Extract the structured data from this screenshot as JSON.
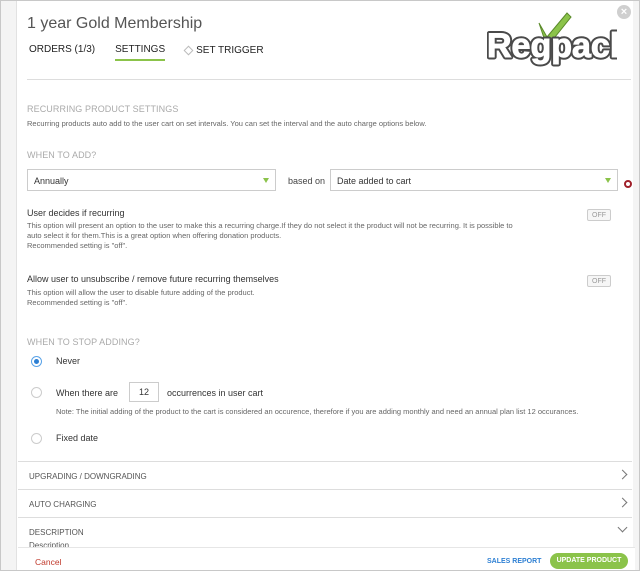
{
  "header": {
    "title": "1 year Gold Membership",
    "close_icon": "close-icon",
    "logo_text": "Regpack"
  },
  "tabs": [
    {
      "label": "ORDERS (1/3)",
      "active": false
    },
    {
      "label": "SETTINGS",
      "active": true
    },
    {
      "label": "SET TRIGGER",
      "active": false
    }
  ],
  "recurring": {
    "title": "RECURRING PRODUCT SETTINGS",
    "description": "Recurring products auto add to the user cart on set intervals. You can set the interval and the auto charge options below."
  },
  "when_to_add": {
    "title": "WHEN TO ADD?",
    "interval_value": "Annually",
    "based_on_label": "based on",
    "based_on_value": "Date added to cart"
  },
  "options": [
    {
      "title": "User decides if recurring",
      "lines": [
        "This option will present an option to the user to make this a recurring charge.If they do not select it the product will not be recurring. It is possible to",
        "auto select it for them.This is a great option when offering donation products.",
        "Recommended setting is \"off\"."
      ],
      "toggle": "OFF"
    },
    {
      "title": "Allow user to unsubscribe / remove future recurring themselves",
      "lines": [
        "This option will allow the user to disable future adding of the product.",
        "Recommended setting is \"off\"."
      ],
      "toggle": "OFF"
    }
  ],
  "when_to_stop": {
    "title": "WHEN TO STOP ADDING?",
    "never_label": "Never",
    "occ_prefix": "When there are",
    "occ_value": "12",
    "occ_suffix": "occurrences in user cart",
    "note": "Note: The initial adding of the product to the cart is considered an occurence, therefore if you are adding monthly and need an annual plan list 12 occurances.",
    "fixed_label": "Fixed date",
    "selected": "Never"
  },
  "sections": [
    {
      "label": "UPGRADING / DOWNGRADING"
    },
    {
      "label": "AUTO CHARGING"
    },
    {
      "label": "DESCRIPTION"
    }
  ],
  "description_sub": "Description",
  "footer": {
    "cancel": "Cancel",
    "sales_report": "SALES REPORT",
    "update": "UPDATE PRODUCT"
  },
  "colors": {
    "accent": "#8bc34a",
    "link": "#2d7fd3",
    "danger": "#c0392b"
  }
}
